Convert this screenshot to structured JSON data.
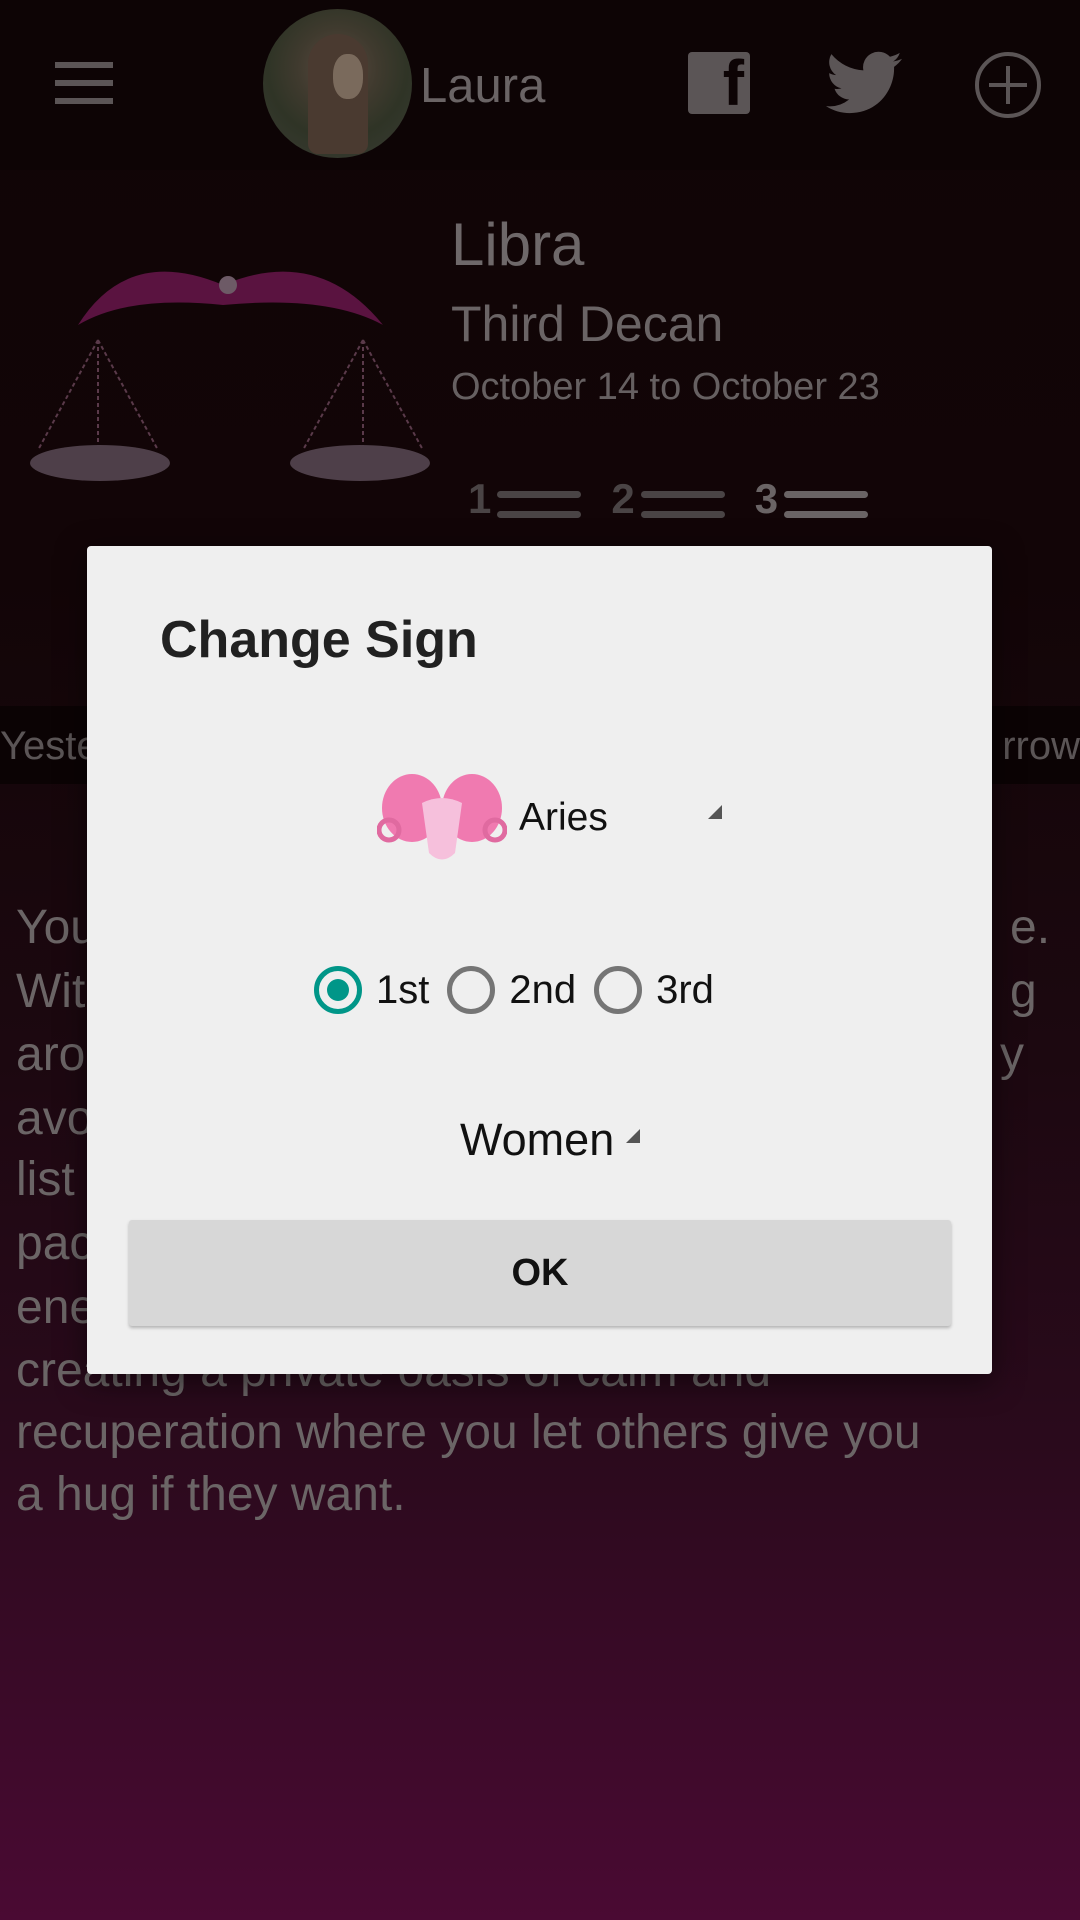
{
  "header": {
    "username": "Laura",
    "icons": [
      "menu-icon",
      "avatar",
      "facebook-icon",
      "twitter-icon",
      "add-circle-icon"
    ]
  },
  "sign_info": {
    "name": "Libra",
    "decan": "Third Decan",
    "date_range": "October 14 to October 23",
    "decans": [
      {
        "label": "1",
        "active": false
      },
      {
        "label": "2",
        "active": false
      },
      {
        "label": "3",
        "active": true
      }
    ]
  },
  "tabs": {
    "left": "Yeste",
    "right": "rrow"
  },
  "body_text": {
    "left_fragments": [
      "You",
      "Wit",
      "aro",
      "avo",
      "list",
      "pac",
      "ene"
    ],
    "right_fragments": [
      "e.",
      "g",
      "y"
    ],
    "full_lines": [
      "creating a private oasis of calm and",
      "recuperation where you let others give you",
      "a hug if they want."
    ]
  },
  "dialog": {
    "title": "Change Sign",
    "sign_select": {
      "value": "Aries",
      "icon": "aries-ram-icon"
    },
    "decan_options": [
      {
        "label": "1st",
        "checked": true
      },
      {
        "label": "2nd",
        "checked": false
      },
      {
        "label": "3rd",
        "checked": false
      }
    ],
    "gender_select": {
      "value": "Women"
    },
    "ok_label": "OK",
    "accent_color": "#009688"
  }
}
